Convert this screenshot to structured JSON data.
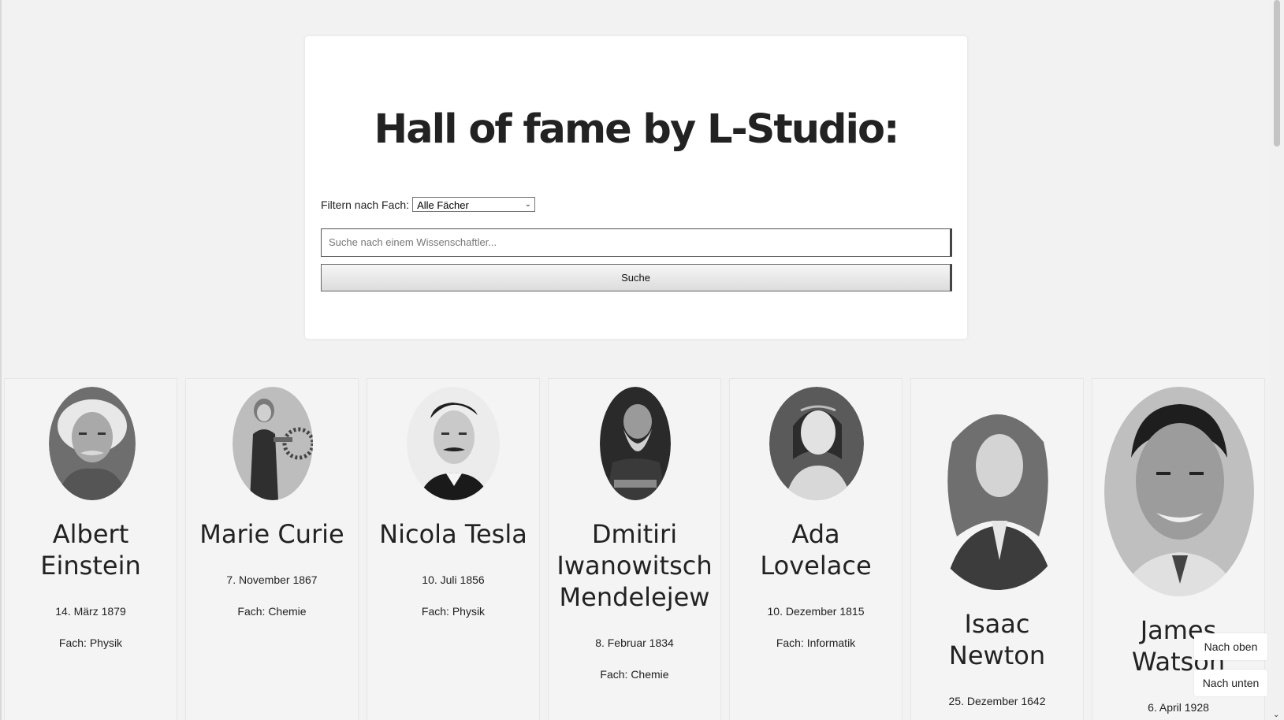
{
  "header": {
    "title": "Hall of fame by L-Studio:",
    "filter_label": "Filtern nach Fach:",
    "filter_selected": "Alle Fächer",
    "search_placeholder": "Suche nach einem Wissenschaftler...",
    "search_button": "Suche"
  },
  "scientists": [
    {
      "name_lines": [
        "Albert",
        "Einstein"
      ],
      "date": "14. März 1879",
      "field": "Fach: Physik"
    },
    {
      "name_lines": [
        "Marie Curie"
      ],
      "date": "7. November 1867",
      "field": "Fach: Chemie"
    },
    {
      "name_lines": [
        "Nicola Tesla"
      ],
      "date": "10. Juli 1856",
      "field": "Fach: Physik"
    },
    {
      "name_lines": [
        "Dmitiri",
        "Iwanowitsch",
        "Mendelejew"
      ],
      "date": "8. Februar 1834",
      "field": "Fach: Chemie"
    },
    {
      "name_lines": [
        "Ada",
        "Lovelace"
      ],
      "date": "10. Dezember 1815",
      "field": "Fach: Informatik"
    },
    {
      "name_lines": [
        "Isaac",
        "Newton"
      ],
      "date": "25. Dezember 1642",
      "field": ""
    },
    {
      "name_lines": [
        "James",
        "Watson"
      ],
      "date": "6. April 1928",
      "field": ""
    }
  ],
  "floating": {
    "up_label": "Nach oben",
    "down_label": "Nach unten"
  },
  "icons": {
    "select_chevron": "chevron-down-icon",
    "scroll_down": "scroll-down-arrow-icon"
  }
}
